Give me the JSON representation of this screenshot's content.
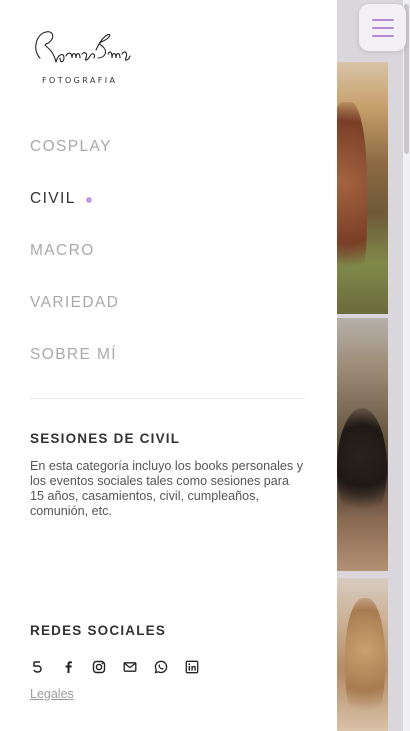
{
  "brand": {
    "script_name": "RamonaEmma",
    "subtitle": "FOTOGRAFIA"
  },
  "nav": {
    "items": [
      {
        "label": "COSPLAY",
        "active": false
      },
      {
        "label": "CIVIL",
        "active": true
      },
      {
        "label": "MACRO",
        "active": false
      },
      {
        "label": "VARIEDAD",
        "active": false
      },
      {
        "label": "SOBRE MÍ",
        "active": false
      }
    ]
  },
  "section": {
    "title": "SESIONES DE CIVIL",
    "description": "En esta categoría incluyo los books personales y los eventos sociales tales como sesiones para 15 años, casamientos, civil, cumpleaños, comunión, etc."
  },
  "social": {
    "title": "REDES SOCIALES",
    "icons": [
      "500px-icon",
      "facebook-icon",
      "instagram-icon",
      "email-icon",
      "whatsapp-icon",
      "linkedin-icon"
    ]
  },
  "footer": {
    "legal_label": "Legales"
  },
  "colors": {
    "accent": "#c69ce0",
    "toggle_bars": "#b48ad0",
    "active_text": "#333333",
    "inactive_text": "#a9a9a9"
  }
}
